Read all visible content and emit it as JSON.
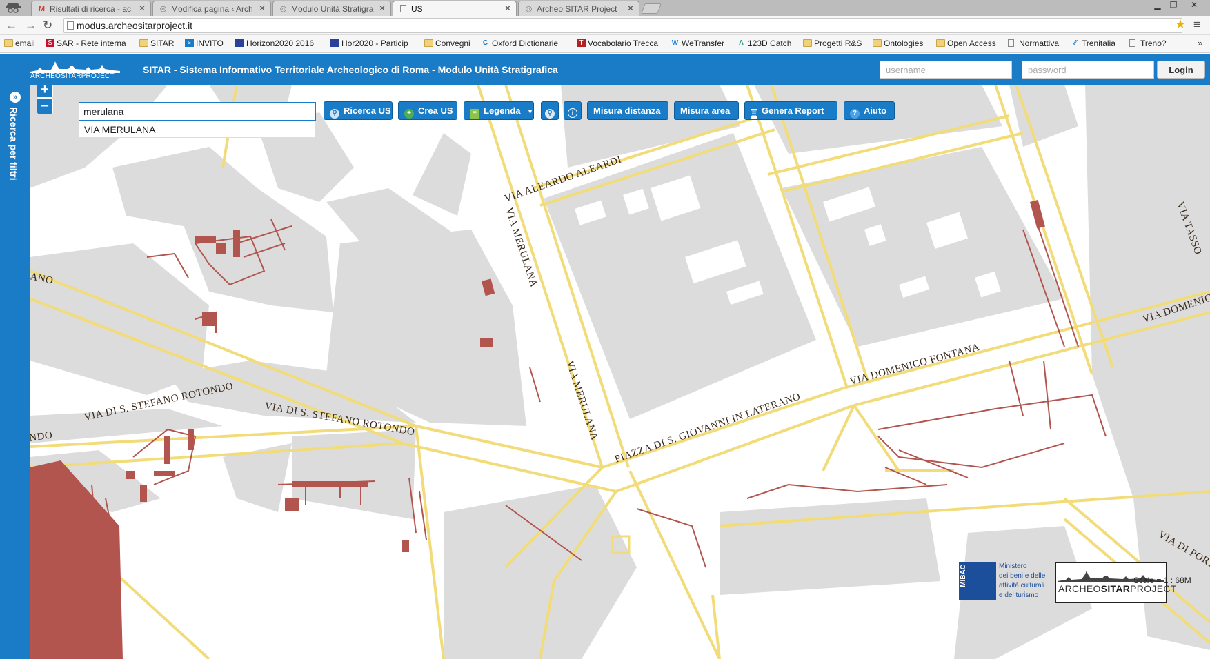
{
  "browser": {
    "tabs": [
      {
        "label": "Risultati di ricerca - ac",
        "icon": "gmail-icon"
      },
      {
        "label": "Modifica pagina ‹ Arch",
        "icon": "wordpress-icon"
      },
      {
        "label": "Modulo Unità Stratigra",
        "icon": "wordpress-icon"
      },
      {
        "label": "US",
        "icon": "page-icon"
      },
      {
        "label": "Archeo SITAR Project",
        "icon": "wordpress-icon"
      }
    ],
    "url": "modus.archeositarproject.it",
    "bookmarks": [
      {
        "label": "email",
        "icon": "folder"
      },
      {
        "label": "SAR - Rete interna",
        "icon": "sar"
      },
      {
        "label": "SITAR",
        "icon": "folder"
      },
      {
        "label": "INVITO",
        "icon": "sitar"
      },
      {
        "label": "Horizon2020 2016",
        "icon": "h2020"
      },
      {
        "label": "Hor2020 - Particip",
        "icon": "h2020"
      },
      {
        "label": "Convegni",
        "icon": "folder"
      },
      {
        "label": "Oxford Dictionarie",
        "icon": "oxford"
      },
      {
        "label": "Vocabolario Trecca",
        "icon": "treccani"
      },
      {
        "label": "WeTransfer",
        "icon": "wetransfer"
      },
      {
        "label": "123D Catch",
        "icon": "catch"
      },
      {
        "label": "Progetti R&S",
        "icon": "folder"
      },
      {
        "label": "Ontologies",
        "icon": "folder"
      },
      {
        "label": "Open Access",
        "icon": "folder"
      },
      {
        "label": "Normattiva",
        "icon": "page"
      },
      {
        "label": "Trenitalia",
        "icon": "trenitalia"
      },
      {
        "label": "Treno?",
        "icon": "page"
      }
    ],
    "bookmarks_more": "»"
  },
  "header": {
    "logo_text": "ARCHEOSITARPROJECT",
    "title": "SITAR - Sistema Informativo Territoriale Archeologico di Roma - Modulo Unità Stratigrafica",
    "username_placeholder": "username",
    "password_placeholder": "password",
    "login_label": "Login"
  },
  "sidepanel": {
    "label": "Ricerca per filtri"
  },
  "map": {
    "search_value": "merulana",
    "suggestion": "VIA MERULANA",
    "toolbar": {
      "ricerca_us": "Ricerca US",
      "crea_us": "Crea US",
      "legenda": "Legenda",
      "misura_distanza": "Misura distanza",
      "misura_area": "Misura area",
      "genera_report": "Genera Report",
      "aiuto": "Aiuto"
    },
    "streets": [
      "VIA ALEARDO ALEARDI",
      "VIA MERULANA",
      "VIA MERULANA",
      "VIA DI S. STEFANO ROTONDO",
      "VIA DI S. STEFANO ROTONDO",
      "PIAZZA DI S. GIOVANNI IN LATERANO",
      "VIA DOMENICO FONTANA",
      "VIA DOMENIC",
      "VIA TASSO",
      "VIA DI PORTA S",
      "ANO",
      "NDO"
    ],
    "mibac": {
      "vertical": "MIBAC",
      "lines": [
        "Ministero",
        "dei beni e delle",
        "attività culturali",
        "e del turismo"
      ]
    },
    "sitar_logo": {
      "prefix": "ARCHEO",
      "bold": "SITAR",
      "suffix": "PROJECT"
    },
    "scale": "Scale = 1 : 68M"
  },
  "colors": {
    "accent": "#1a7bc7",
    "road": "#f2dc7a",
    "block": "#dcdcdc",
    "archaeology": "#b3554f"
  }
}
